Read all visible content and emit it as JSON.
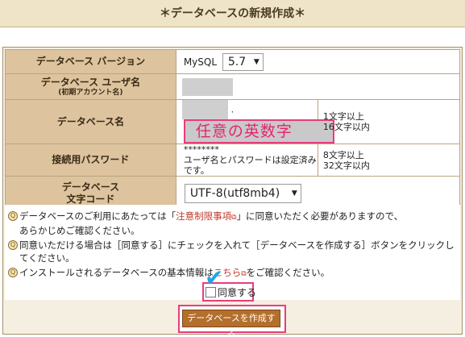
{
  "title": "＊データベースの新規作成＊",
  "form": {
    "version_label": "データベース バージョン",
    "mysql_label": "MySQL",
    "version_value": "5.7",
    "user_label": "データベース ユーザ名",
    "user_sublabel": "(初期アカウント名)",
    "dbname_label": "データベース名",
    "dbname_dot": ".",
    "dbname_annotation": "任意の英数字",
    "dbname_note_line1": "1文字以上",
    "dbname_note_line2": "16文字以内",
    "password_label": "接続用パスワード",
    "password_value": "********",
    "password_info": "ユーザ名とパスワードは設定済みです。",
    "password_note_line1": "8文字以上",
    "password_note_line2": "32文字以内",
    "charset_label_line1": "データベース",
    "charset_label_line2": "文字コード",
    "charset_value": "UTF-8(utf8mb4)"
  },
  "notes": {
    "line1_before": "データベースのご利用にあたっては「",
    "line1_link": "注意制限事項",
    "line1_after": "」に同意いただく必要がありますので、",
    "line1_cont": "あらかじめご確認ください。",
    "line2": "同意いただける場合は［同意する］にチェックを入れて［データベースを作成する］ボタンをクリックしてください。",
    "line3_before": "インストールされるデータベースの基本情報は",
    "line3_link": "こちら",
    "line3_after": "をご確認ください。"
  },
  "agree_label": "同意する",
  "create_button": "データベースを作成する"
}
